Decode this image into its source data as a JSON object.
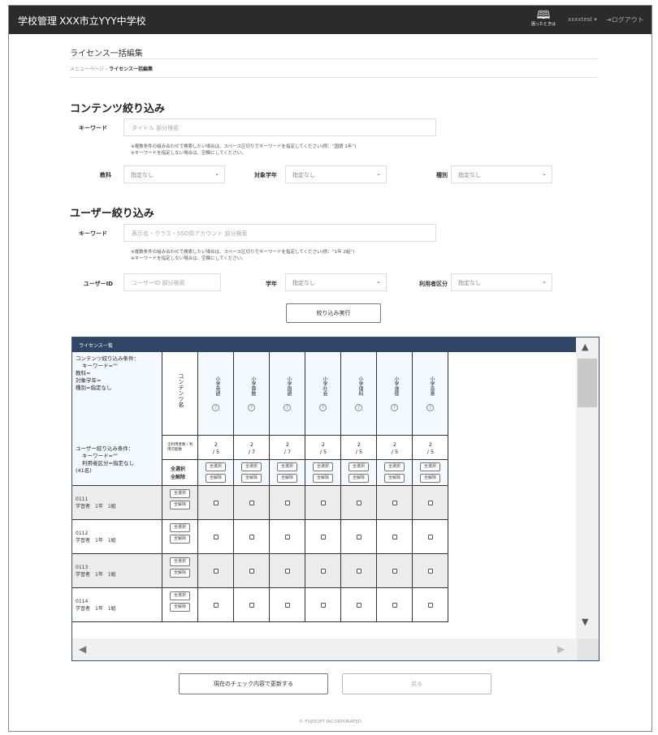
{
  "header": {
    "brand": "学校管理",
    "school": "XXX市立YYY中学校",
    "help_label": "困ったときは",
    "user_menu": "xxxxtest ▾",
    "logout": "ログアウト"
  },
  "page": {
    "title": "ライセンス一括編集",
    "breadcrumb_home": "メニューページ",
    "breadcrumb_sep": "›",
    "breadcrumb_current": "ライセンス一括編集"
  },
  "content_filter": {
    "heading": "コンテンツ絞り込み",
    "keyword_label": "キーワード",
    "keyword_placeholder": "タイトル 部分検索",
    "note1": "※複数条件の組み合わせで検索したい場合は、スペース区切りでキーワードを指定してください(例：“国語 1年”)",
    "note2": "※キーワードを指定しない場合は、空欄にしてください。",
    "subject_label": "教科",
    "subject_value": "指定なし",
    "grade_label": "対象学年",
    "grade_value": "指定なし",
    "type_label": "種別",
    "type_value": "指定なし"
  },
  "user_filter": {
    "heading": "ユーザー絞り込み",
    "keyword_label": "キーワード",
    "keyword_placeholder": "表示名・クラス・SSO用アカウント 部分検索",
    "note1": "※複数条件の組み合わせで検索したい場合は、スペース区切りでキーワードを指定してください(例：“1年 2組”)",
    "note2": "※キーワードを指定しない場合は、空欄にしてください。",
    "userid_label": "ユーザーID",
    "userid_placeholder": "ユーザーID 部分検索",
    "year_label": "学年",
    "year_value": "指定なし",
    "usertype_label": "利用者区分",
    "usertype_value": "指定なし",
    "submit": "絞り込み実行"
  },
  "license_table": {
    "title": "ライセンス一覧",
    "content_cond_lines": [
      "コンテンツ絞り込み条件：",
      "キーワード=\"\"",
      "教科=",
      "対象学年=",
      "種別=指定なし"
    ],
    "content_col_label": "コンテンツ名",
    "ratio_label": "全利用者数 / 利用可能数",
    "user_cond_lines": [
      "ユーザー絞り込み条件：",
      "キーワード=\"\"",
      "利用者区分=指定なし",
      "(41名)"
    ],
    "select_all_labels": [
      "全選択",
      "全解除"
    ],
    "btn_select_all": "全選択",
    "btn_clear_all": "全解除",
    "columns": [
      {
        "name": "小学英語",
        "used": "2",
        "total": "/ 5"
      },
      {
        "name": "小学算数",
        "used": "2",
        "total": "/ 7"
      },
      {
        "name": "小学国語",
        "used": "2",
        "total": "/ 7"
      },
      {
        "name": "小学社会",
        "used": "2",
        "total": "/ 5"
      },
      {
        "name": "小学理科",
        "used": "2",
        "total": "/ 5"
      },
      {
        "name": "小学道徳",
        "used": "2",
        "total": "/ 5"
      },
      {
        "name": "小学音楽",
        "used": "2",
        "total": "/ 5"
      }
    ],
    "rows": [
      {
        "id": "0111",
        "info": "学習者　1年　1組"
      },
      {
        "id": "0112",
        "info": "学習者　1年　1組"
      },
      {
        "id": "0113",
        "info": "学習者　1年　1組"
      },
      {
        "id": "0114",
        "info": "学習者　1年　1組"
      }
    ]
  },
  "actions": {
    "update": "現在のチェック内容で更新する",
    "back": "戻る"
  },
  "footer": "© FUJISOFT INCORPORATED"
}
